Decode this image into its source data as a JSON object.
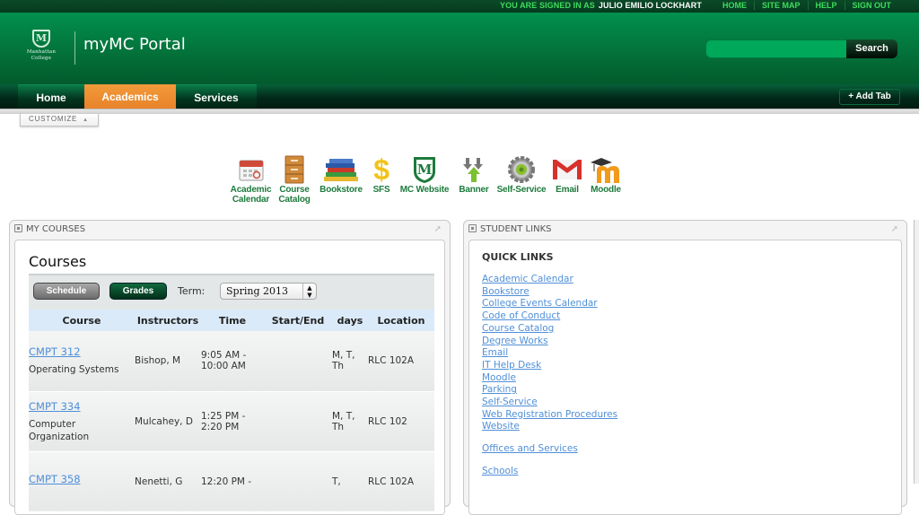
{
  "utility": {
    "signed_in_label": "YOU ARE SIGNED IN AS",
    "user_name": "JULIO EMILIO LOCKHART",
    "links": [
      "HOME",
      "SITE MAP",
      "HELP",
      "SIGN OUT"
    ]
  },
  "header": {
    "logo_line1": "Manhattan",
    "logo_line2": "College",
    "logo_mark": "M",
    "title": "myMC Portal",
    "search_placeholder": "",
    "search_button": "Search"
  },
  "nav": {
    "tabs": [
      {
        "label": "Home",
        "active": false
      },
      {
        "label": "Academics",
        "active": true
      },
      {
        "label": "Services",
        "active": false
      }
    ],
    "add_tab": "+ Add Tab",
    "customize": "CUSTOMIZE"
  },
  "quick_icons": [
    {
      "label1": "Academic",
      "label2": "Calendar",
      "icon": "calendar-icon"
    },
    {
      "label1": "Course",
      "label2": "Catalog",
      "icon": "cabinet-icon"
    },
    {
      "label1": "Bookstore",
      "label2": "",
      "icon": "books-icon"
    },
    {
      "label1": "SFS",
      "label2": "",
      "icon": "dollar-icon"
    },
    {
      "label1": "MC Website",
      "label2": "",
      "icon": "mc-shield-icon"
    },
    {
      "label1": "Banner",
      "label2": "",
      "icon": "arrows-icon"
    },
    {
      "label1": "Self-Service",
      "label2": "",
      "icon": "gear-icon"
    },
    {
      "label1": "Email",
      "label2": "",
      "icon": "gmail-icon"
    },
    {
      "label1": "Moodle",
      "label2": "",
      "icon": "moodle-icon"
    }
  ],
  "my_courses": {
    "portlet_title": "MY COURSES",
    "heading": "Courses",
    "schedule_button": "Schedule",
    "grades_button": "Grades",
    "term_label": "Term:",
    "term_value": "Spring 2013",
    "columns": [
      "Course",
      "Instructors",
      "Time",
      "Start/End",
      "days",
      "Location"
    ],
    "rows": [
      {
        "code": "CMPT 312",
        "name": "Operating Systems",
        "instructor": "Bishop, M",
        "time": "9:05 AM - 10:00 AM",
        "start_end": "",
        "days": "M, T, Th",
        "location": "RLC 102A"
      },
      {
        "code": "CMPT 334",
        "name": "Computer Organization",
        "instructor": "Mulcahey, D",
        "time": "1:25 PM - 2:20 PM",
        "start_end": "",
        "days": "M, T, Th",
        "location": "RLC 102"
      },
      {
        "code": "CMPT 358",
        "name": "",
        "instructor": "Nenetti, G",
        "time": "12:20 PM -",
        "start_end": "",
        "days": "T,",
        "location": "RLC 102A"
      }
    ]
  },
  "student_links": {
    "portlet_title": "STUDENT LINKS",
    "heading": "QUICK LINKS",
    "links": [
      "Academic Calendar",
      "Bookstore",
      "College Events Calendar",
      "Code of Conduct",
      "Course Catalog",
      "Degree Works",
      "Email",
      "IT Help Desk",
      "Moodle",
      "Parking",
      "Self-Service",
      "Web Registration Procedures",
      "Website"
    ],
    "offices": "Offices and Services",
    "schools": "Schools"
  },
  "colors": {
    "brand_green": "#036a36",
    "active_tab": "#f0913a",
    "link": "#4f8fd8",
    "icon_label": "#1d7a3c"
  }
}
